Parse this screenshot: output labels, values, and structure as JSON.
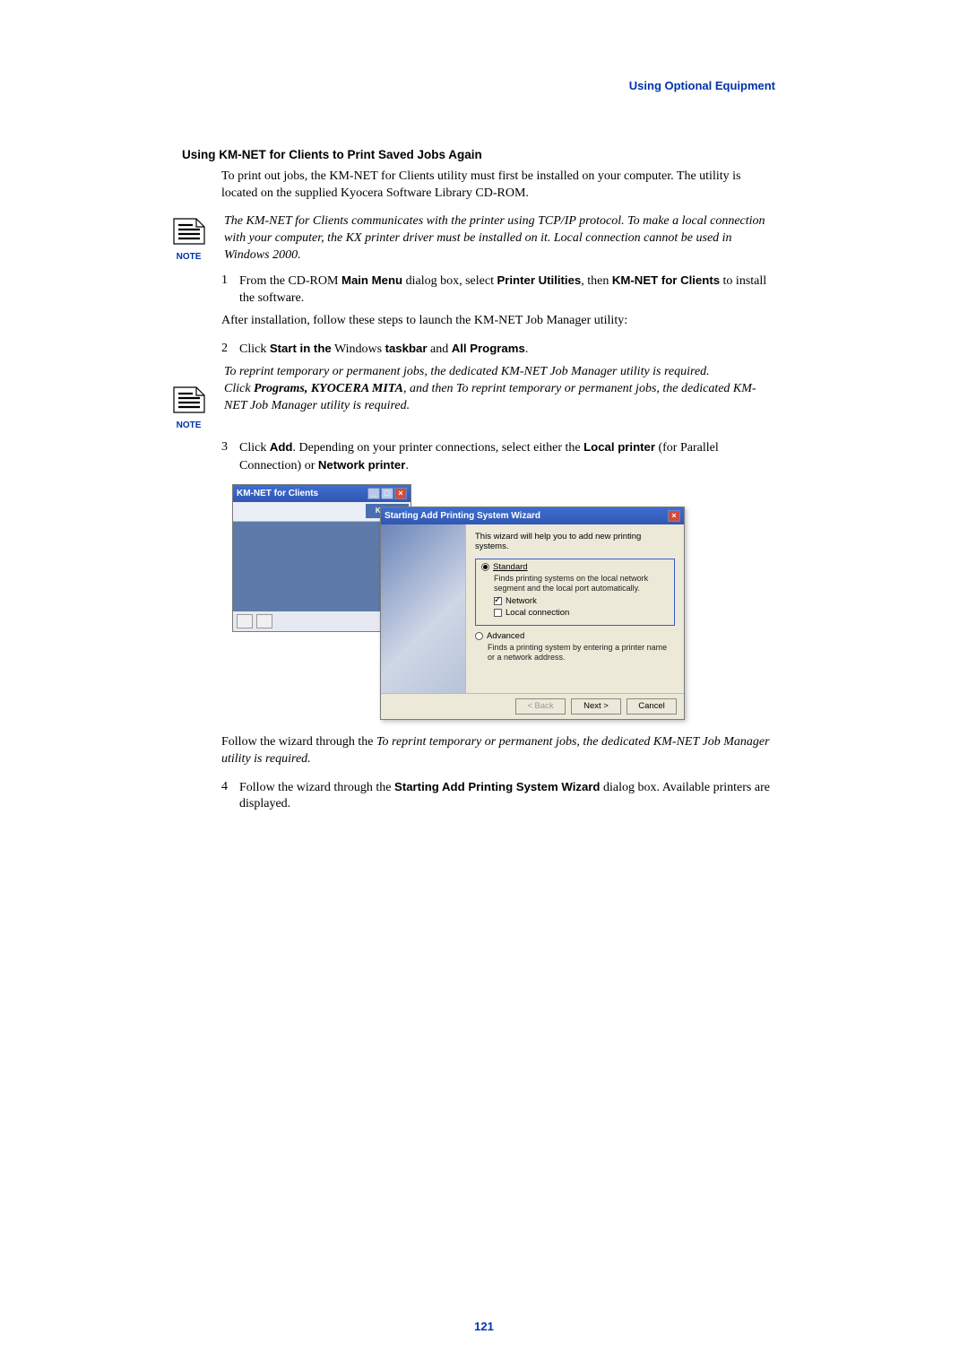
{
  "header": {
    "section": "Using Optional Equipment"
  },
  "heading": "Using KM-NET for Clients to Print Saved Jobs Again",
  "intro": "To print out jobs, the KM-NET for Clients utility must first be installed on your computer. The utility is located on the supplied Kyocera Software Library CD-ROM.",
  "note1": {
    "label": "NOTE",
    "text": "The KM-NET for Clients communicates with the printer using TCP/IP protocol. To make a local connection with your computer, the KX printer driver must be installed on it. Local connection cannot be used in Windows 2000."
  },
  "step1": {
    "num": "1",
    "pre": "From the CD-ROM ",
    "b1": "Main Menu",
    "mid1": " dialog box, select ",
    "b2": "Printer Utilities",
    "mid2": ", then ",
    "b3": "KM-NET for Clients",
    "post": " to install the software."
  },
  "after_install": "After installation, follow these steps to launch the KM-NET Job Manager utility:",
  "step2": {
    "num": "2",
    "pre": "Click ",
    "b1": "Start in the",
    "mid1": " Windows ",
    "b2": "taskbar",
    "mid2": " and ",
    "b3": "All Programs",
    "post": "."
  },
  "note2": {
    "label": "NOTE",
    "line1": "To reprint temporary or permanent jobs, the dedicated KM-NET Job Manager utility is required.",
    "line2_pre": " Click ",
    "line2_b": "Programs, KYOCERA MITA",
    "line2_post": ", and then To reprint temporary or permanent jobs, the dedicated KM-NET Job Manager utility is required."
  },
  "step3": {
    "num": "3",
    "pre": "Click ",
    "b1": "Add",
    "mid1": ". Depending on your printer connections, select either the ",
    "b2": "Local printer",
    "mid2": " (for Parallel Connection) or ",
    "b3": "Network printer",
    "post": "."
  },
  "dialogs": {
    "km": {
      "title": "KM-NET for Clients",
      "logo": "KM-NE"
    },
    "wizard": {
      "title": "Starting Add Printing System Wizard",
      "intro": "This wizard will help you to add new printing systems.",
      "standard_label": "Standard",
      "standard_desc": "Finds printing systems on the local network segment and the local port automatically.",
      "network_label": "Network",
      "local_label": "Local connection",
      "advanced_label": "Advanced",
      "advanced_desc": "Finds a printing system by entering a printer name or a network address.",
      "back": "< Back",
      "next": "Next >",
      "cancel": "Cancel"
    }
  },
  "follow_para_pre": "Follow the wizard through the ",
  "follow_para_it": "To reprint temporary or permanent jobs, the dedicated KM-NET Job Manager utility is required.",
  "step4": {
    "num": "4",
    "pre": "Follow the wizard through the ",
    "b1": "Starting Add Printing System Wizard",
    "post": " dialog box. Available printers are displayed."
  },
  "page": "121"
}
